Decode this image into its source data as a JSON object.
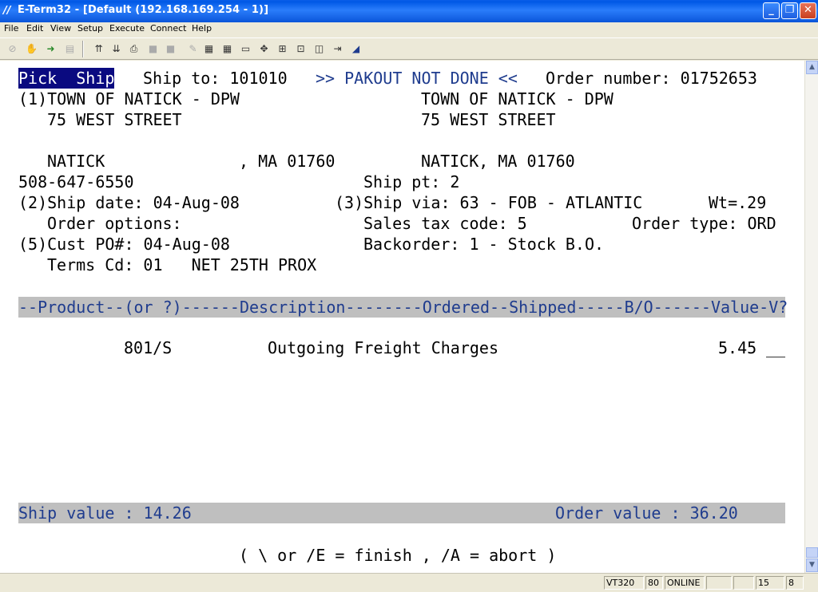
{
  "window": {
    "title": "E-Term32 - [Default (192.168.169.254 - 1)]",
    "icon": "eterm-app-icon",
    "minimize": "_",
    "restore": "❐",
    "close": "✕"
  },
  "menu": [
    "File",
    "Edit",
    "View",
    "Setup",
    "Execute",
    "Connect",
    "Help"
  ],
  "toolbar": {
    "icons": [
      "disconnect-icon",
      "hand-icon",
      "connect-icon",
      "print-screen-icon",
      "upload-icon",
      "download-icon",
      "print-icon",
      "copy-icon",
      "paste-icon",
      "edit-icon",
      "capture-icon",
      "log-icon",
      "display-icon",
      "target-icon",
      "send-icon",
      "receive-icon",
      "macro-icon",
      "exit-icon",
      "script-icon"
    ]
  },
  "terminal": {
    "pick_ship": "Pick  Ship",
    "ship_to": "Ship to: 101010",
    "pakout": ">> PAKOUT NOT DONE <<",
    "order_number": "Order number: 01752653",
    "bill_name": "(1)TOWN OF NATICK - DPW",
    "ship_name": "TOWN OF NATICK - DPW",
    "bill_street": "75 WEST STREET",
    "ship_street": "75 WEST STREET",
    "bill_city": "NATICK",
    "bill_state_zip": ", MA 01760",
    "ship_city_state_zip": "NATICK, MA 01760",
    "phone": "508-647-6550",
    "ship_pt": "Ship pt: 2",
    "ship_date": "(2)Ship date: 04-Aug-08",
    "ship_via": "(3)Ship via: 63 - FOB - ATLANTIC",
    "weight": "Wt=.29",
    "order_options": "Order options:",
    "sales_tax": "Sales tax code: 5",
    "order_type": "Order type: ORD",
    "cust_po": "(5)Cust PO#: 04-Aug-08",
    "backorder": "Backorder: 1 - Stock B.O.",
    "terms": "Terms Cd: 01   NET 25TH PROX",
    "column_header": "--Product--(or ?)------Description--------Ordered--Shipped-----B/O------Value-V?",
    "line_items": [
      {
        "product": "801/S",
        "description": "Outgoing Freight Charges",
        "value": "5.45",
        "v": "__"
      }
    ],
    "ship_value": "Ship value : 14.26",
    "order_value": "Order value : 36.20",
    "hint": "( \\ or /E = finish , /A = abort )"
  },
  "status": {
    "emulation": "VT320",
    "columns": "80",
    "connection": "ONLINE",
    "blank1": "",
    "blank2": "",
    "row": "15",
    "col": "8"
  }
}
